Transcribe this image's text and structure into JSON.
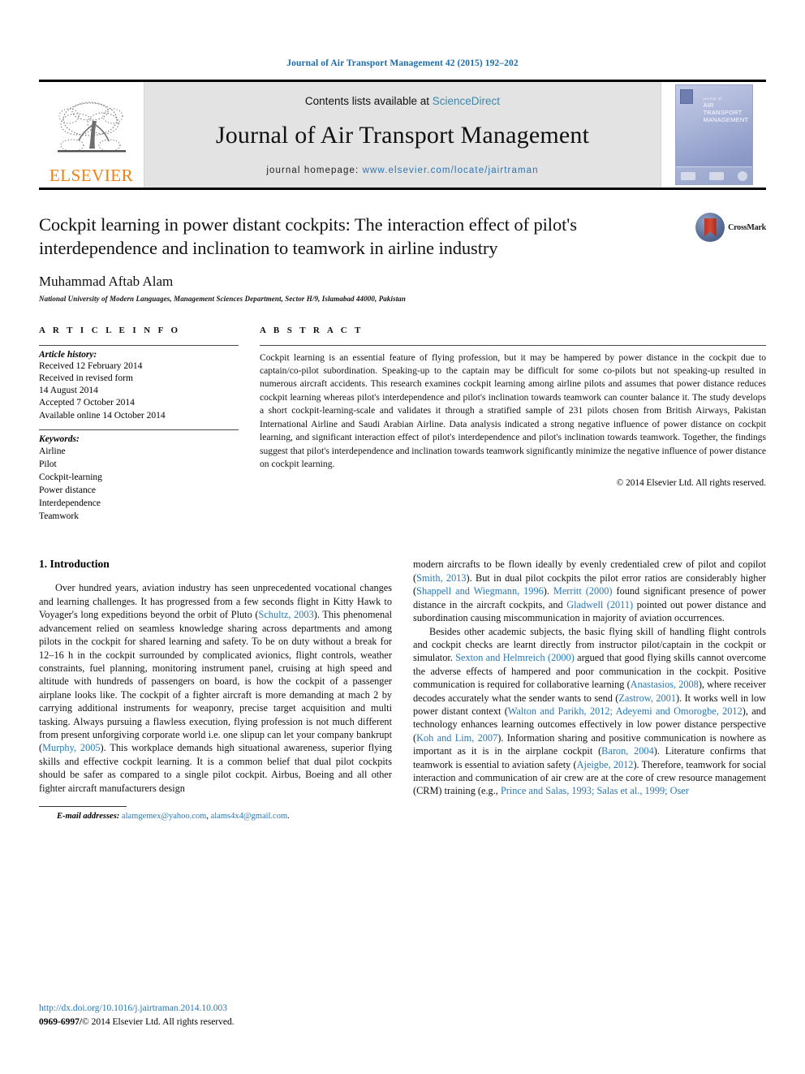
{
  "running_head": "Journal of Air Transport Management 42 (2015) 192–202",
  "masthead": {
    "publisher_name": "ELSEVIER",
    "publisher_logo_alt": "elsevier-tree-logo",
    "contents_prefix": "Contents lists available at",
    "contents_link": "ScienceDirect",
    "journal_name": "Journal of Air Transport Management",
    "homepage_prefix": "journal homepage:",
    "homepage_url": "www.elsevier.com/locate/jairtraman",
    "cover_title_small": "journal of",
    "cover_title_line1": "AIR TRANSPORT",
    "cover_title_line2": "MANAGEMENT"
  },
  "article": {
    "title": "Cockpit learning in power distant cockpits: The interaction effect of pilot's interdependence and inclination to teamwork in airline industry",
    "author": "Muhammad Aftab Alam",
    "affiliation": "National University of Modern Languages, Management Sciences Department, Sector H/9, Islamabad 44000, Pakistan",
    "crossmark_label": "CrossMark"
  },
  "article_info": {
    "heading": "A R T I C L E   I N F O",
    "history_label": "Article history:",
    "history": [
      "Received 12 February 2014",
      "Received in revised form",
      "14 August 2014",
      "Accepted 7 October 2014",
      "Available online 14 October 2014"
    ],
    "keywords_label": "Keywords:",
    "keywords": [
      "Airline",
      "Pilot",
      "Cockpit-learning",
      "Power distance",
      "Interdependence",
      "Teamwork"
    ]
  },
  "abstract": {
    "heading": "A B S T R A C T",
    "text": "Cockpit learning is an essential feature of flying profession, but it may be hampered by power distance in the cockpit due to captain/co-pilot subordination. Speaking-up to the captain may be difficult for some co-pilots but not speaking-up resulted in numerous aircraft accidents. This research examines cockpit learning among airline pilots and assumes that power distance reduces cockpit learning whereas pilot's interdependence and pilot's inclination towards teamwork can counter balance it. The study develops a short cockpit-learning-scale and validates it through a stratified sample of 231 pilots chosen from British Airways, Pakistan International Airline and Saudi Arabian Airline. Data analysis indicated a strong negative influence of power distance on cockpit learning, and significant interaction effect of pilot's interdependence and pilot's inclination towards teamwork. Together, the findings suggest that pilot's interdependence and inclination towards teamwork significantly minimize the negative influence of power distance on cockpit learning.",
    "copyright": "© 2014 Elsevier Ltd. All rights reserved."
  },
  "body": {
    "section_title": "1.  Introduction",
    "left_para_1_a": "Over hundred years, aviation industry has seen unprecedented vocational changes and learning challenges. It has progressed from a few seconds flight in Kitty Hawk to Voyager's long expeditions beyond the orbit of Pluto (",
    "left_ref_1": "Schultz, 2003",
    "left_para_1_b": "). This phenomenal advancement relied on seamless knowledge sharing across departments and among pilots in the cockpit for shared learning and safety. To be on duty without a break for 12–16 h in the cockpit surrounded by complicated avionics, flight controls, weather constraints, fuel planning, monitoring instrument panel, cruising at high speed and altitude with hundreds of passengers on board, is how the cockpit of a passenger airplane looks like. The cockpit of a fighter aircraft is more demanding at mach 2 by carrying additional instruments for weaponry, precise target acquisition and multi tasking. Always pursuing a flawless execution, flying profession is not much different from present unforgiving corporate world i.e. one slipup can let your company bankrupt (",
    "left_ref_2": "Murphy, 2005",
    "left_para_1_c": "). This workplace demands high situational awareness, superior flying skills and effective cockpit learning. It is a common belief that dual pilot cockpits should be safer as compared to a single pilot cockpit. Airbus, Boeing and all other fighter aircraft manufacturers design",
    "right_para_1_a": "modern aircrafts to be flown ideally by evenly credentialed crew of pilot and copilot (",
    "right_ref_1": "Smith, 2013",
    "right_para_1_b": "). But in dual pilot cockpits the pilot error ratios are considerably higher (",
    "right_ref_2": "Shappell and Wiegmann, 1996",
    "right_para_1_c": "). ",
    "right_ref_3": "Merritt (2000)",
    "right_para_1_d": " found significant presence of power distance in the aircraft cockpits, and ",
    "right_ref_4": "Gladwell (2011)",
    "right_para_1_e": " pointed out power distance and subordination causing miscommunication in majority of aviation occurrences.",
    "right_para_2_a": "Besides other academic subjects, the basic flying skill of handling flight controls and cockpit checks are learnt directly from instructor pilot/captain in the cockpit or simulator. ",
    "right_ref_5": "Sexton and Helmreich (2000)",
    "right_para_2_b": " argued that good flying skills cannot overcome the adverse effects of hampered and poor communication in the cockpit. Positive communication is required for collaborative learning (",
    "right_ref_6": "Anastasios, 2008",
    "right_para_2_c": "), where receiver decodes accurately what the sender wants to send (",
    "right_ref_7": "Zastrow, 2001",
    "right_para_2_d": "). It works well in low power distant context (",
    "right_ref_8": "Walton and Parikh, 2012; Adeyemi and Omorogbe, 2012",
    "right_para_2_e": "), and technology enhances learning outcomes effectively in low power distance perspective (",
    "right_ref_9": "Koh and Lim, 2007",
    "right_para_2_f": "). Information sharing and positive communication is nowhere as important as it is in the airplane cockpit (",
    "right_ref_10": "Baron, 2004",
    "right_para_2_g": "). Literature confirms that teamwork is essential to aviation safety (",
    "right_ref_11": "Ajeigbe, 2012",
    "right_para_2_h": "). Therefore, teamwork for social interaction and communication of air crew are at the core of crew resource management (CRM) training (e.g., ",
    "right_ref_12": "Prince and Salas, 1993; Salas et al., 1999; Oser"
  },
  "footnote": {
    "label": "E-mail addresses:",
    "email1": "alamgemex@yahoo.com",
    "separator": ", ",
    "email2": "alams4x4@gmail.com",
    "trailing": "."
  },
  "page_footer": {
    "doi": "http://dx.doi.org/10.1016/j.jairtraman.2014.10.003",
    "issn_prefix": "0969-6997/",
    "issn_rest": "© 2014 Elsevier Ltd. All rights reserved."
  },
  "colors": {
    "link": "#2878b5",
    "running_head": "#1a6ba8",
    "elsevier_orange": "#f07f13",
    "masthead_gray": "#e3e3e3"
  }
}
